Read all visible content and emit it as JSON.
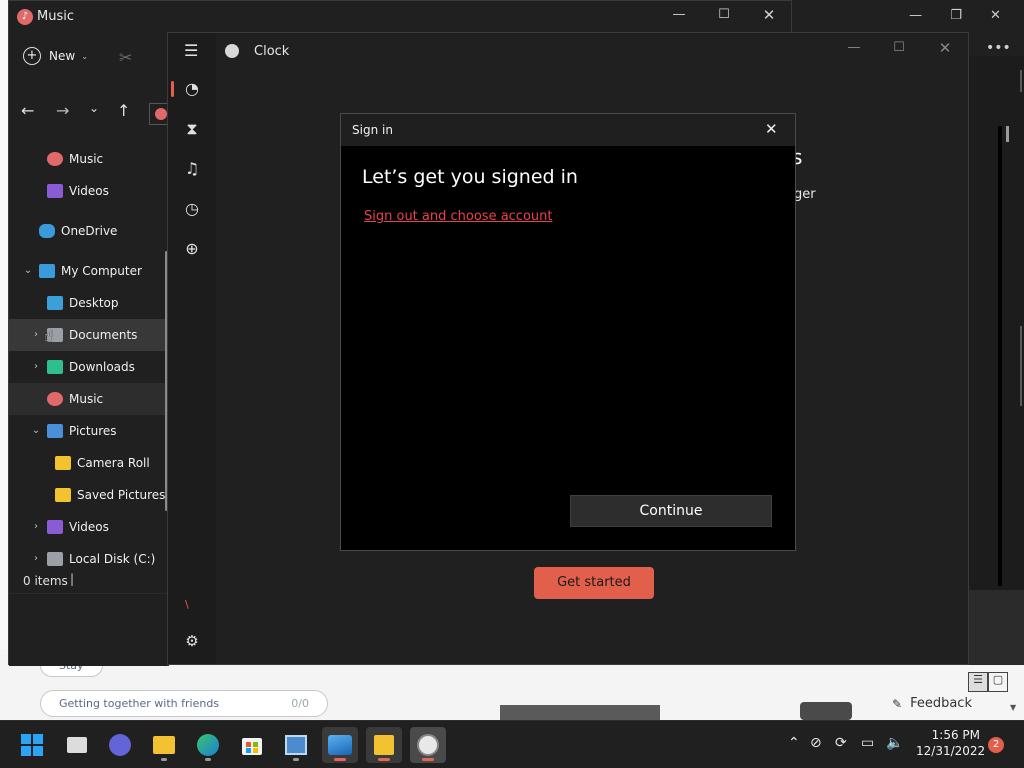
{
  "explorer": {
    "title": "Music",
    "new_label": "New",
    "status_items": "0 items",
    "nav": [
      {
        "label": "Music",
        "indent": 1,
        "chev": "",
        "icon": "music"
      },
      {
        "label": "Videos",
        "indent": 1,
        "chev": "",
        "icon": "video"
      },
      {
        "label": "OneDrive",
        "indent": 0,
        "chev": "",
        "icon": "cloud"
      },
      {
        "label": "My Computer",
        "indent": 0,
        "chev": "expanded",
        "icon": "computer"
      },
      {
        "label": "Desktop",
        "indent": 1,
        "chev": "",
        "icon": "desktop"
      },
      {
        "label": "Documents",
        "indent": 1,
        "chev": "collapsed",
        "icon": "documents"
      },
      {
        "label": "Downloads",
        "indent": 1,
        "chev": "collapsed",
        "icon": "download"
      },
      {
        "label": "Music",
        "indent": 1,
        "chev": "",
        "icon": "music"
      },
      {
        "label": "Pictures",
        "indent": 1,
        "chev": "expanded",
        "icon": "pictures"
      },
      {
        "label": "Camera Roll",
        "indent": 2,
        "chev": "",
        "icon": "folder"
      },
      {
        "label": "Saved Pictures",
        "indent": 2,
        "chev": "",
        "icon": "folder"
      },
      {
        "label": "Videos",
        "indent": 1,
        "chev": "collapsed",
        "icon": "video"
      },
      {
        "label": "Local Disk (C:)",
        "indent": 1,
        "chev": "collapsed",
        "icon": "disk"
      }
    ]
  },
  "clock": {
    "title": "Clock",
    "get_started_label": "Get started",
    "partial_heading": "s",
    "partial_text": "ger"
  },
  "dialog": {
    "title": "Sign in",
    "heading": "Let’s get you signed in",
    "link": "Sign out and choose account",
    "continue_label": "Continue"
  },
  "background": {
    "pill_text": "Getting together with friends",
    "pill_count": "0/0",
    "pill_small": "Stay",
    "feedback_label": "Feedback"
  },
  "taskbar": {
    "time": "1:56 PM",
    "date": "12/31/2022",
    "notifications": "2"
  },
  "colors": {
    "accent": "#e25f4c",
    "link": "#e8414f"
  }
}
